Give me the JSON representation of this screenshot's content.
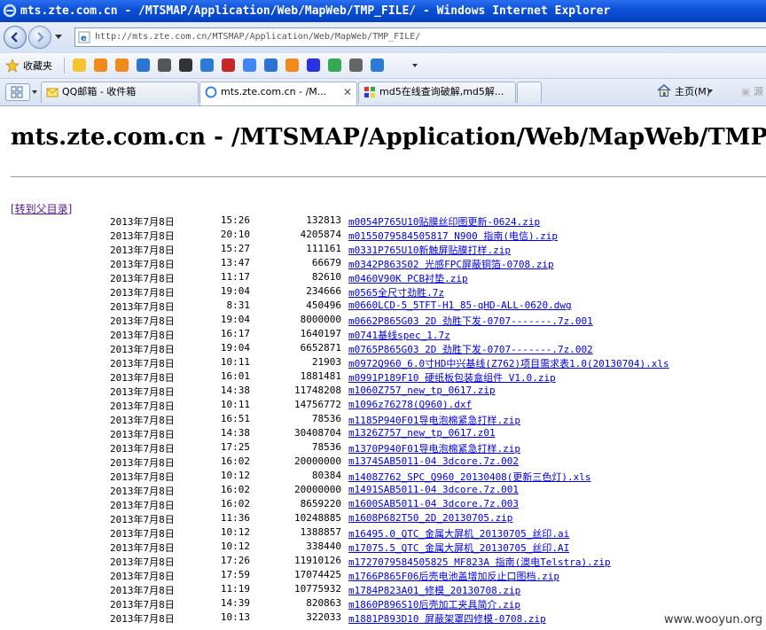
{
  "window": {
    "title": "mts.zte.com.cn - /MTSMAP/Application/Web/MapWeb/TMP_FILE/ - Windows Internet Explorer"
  },
  "address_bar": {
    "url": "http://mts.zte.com.cn/MTSMAP/Application/Web/MapWeb/TMP_FILE/"
  },
  "favorites_bar": {
    "label": "收藏夹",
    "icons": [
      "add-favorite-icon",
      "orange-site-icon",
      "orange-site-icon",
      "blue-site-icon",
      "link-icon",
      "download-icon",
      "ie-icon",
      "red-site-icon",
      "translate-icon",
      "blue-site-icon",
      "orange-site-icon",
      "baidu-paw-icon",
      "chrome-icon",
      "grid-icon",
      "ie-icon"
    ]
  },
  "tabs": [
    {
      "label": "QQ邮箱 - 收件箱",
      "active": false
    },
    {
      "label": "mts.zte.com.cn - /M...",
      "active": true
    },
    {
      "label": "md5在线查询破解,md5解...",
      "active": false
    }
  ],
  "toolbar": {
    "home_label": "主页(M)",
    "feeds_label": "源"
  },
  "page": {
    "title": "mts.zte.com.cn - /MTSMAP/Application/Web/MapWeb/TMP_FILE/",
    "parent_link": "[转到父目录]",
    "files": [
      {
        "date": "2013年7月8日",
        "time": "15:26",
        "size": "132813",
        "name": "m0054P765U10贴膜丝印图更新-0624.zip"
      },
      {
        "date": "2013年7月8日",
        "time": "20:10",
        "size": "4205874",
        "name": "m0155079584505817 N900 指南(电信).zip"
      },
      {
        "date": "2013年7月8日",
        "time": "15:27",
        "size": "111161",
        "name": "m0331P765U10新触屏贴膜打样.zip"
      },
      {
        "date": "2013年7月8日",
        "time": "13:47",
        "size": "66679",
        "name": "m0342P863S02 光感FPC屏蔽铜箔-0708.zip"
      },
      {
        "date": "2013年7月8日",
        "time": "11:17",
        "size": "82610",
        "name": "m0460V90K PCB衬垫.zip"
      },
      {
        "date": "2013年7月8日",
        "time": "19:04",
        "size": "234666",
        "name": "m0565全尺寸劲胜.7z"
      },
      {
        "date": "2013年7月8日",
        "time": "8:31",
        "size": "450496",
        "name": "m0660LCD-5_5TFT-H1_85-qHD-ALL-0620.dwg"
      },
      {
        "date": "2013年7月8日",
        "time": "19:04",
        "size": "8000000",
        "name": "m0662P865G03 2D 劲胜下发-0707-------.7z.001"
      },
      {
        "date": "2013年7月8日",
        "time": "16:17",
        "size": "1640197",
        "name": "m0741基线spec_1.7z"
      },
      {
        "date": "2013年7月8日",
        "time": "19:04",
        "size": "6652871",
        "name": "m0765P865G03 2D 劲胜下发-0707-------.7z.002"
      },
      {
        "date": "2013年7月8日",
        "time": "10:11",
        "size": "21903",
        "name": "m0972Q960_6.0寸HD中兴基线(Z762)项目需求表1.0(20130704).xls"
      },
      {
        "date": "2013年7月8日",
        "time": "16:01",
        "size": "1881481",
        "name": "m0991P189F10 硬纸板包装盒组件 V1.0.zip"
      },
      {
        "date": "2013年7月8日",
        "time": "14:38",
        "size": "11748208",
        "name": "m1060Z757_new_tp_0617.zip"
      },
      {
        "date": "2013年7月8日",
        "time": "10:11",
        "size": "14756772",
        "name": "m1096z76278(Q960).dxf"
      },
      {
        "date": "2013年7月8日",
        "time": "16:51",
        "size": "78536",
        "name": "m1185P940F01导电泡棉紧急打样.zip"
      },
      {
        "date": "2013年7月8日",
        "time": "14:38",
        "size": "30408704",
        "name": "m1326Z757_new_tp_0617.z01"
      },
      {
        "date": "2013年7月8日",
        "time": "17:25",
        "size": "78536",
        "name": "m1370P940F01导电泡棉紧急打样.zip"
      },
      {
        "date": "2013年7月8日",
        "time": "16:02",
        "size": "20000000",
        "name": "m1374SAB5011-04 3dcore.7z.002"
      },
      {
        "date": "2013年7月8日",
        "time": "10:12",
        "size": "80384",
        "name": "m1408Z762_SPC_Q960_20130408(更新三色灯).xls"
      },
      {
        "date": "2013年7月8日",
        "time": "16:02",
        "size": "20000000",
        "name": "m1491SAB5011-04 3dcore.7z.001"
      },
      {
        "date": "2013年7月8日",
        "time": "16:02",
        "size": "8659220",
        "name": "m1600SAB5011-04 3dcore.7z.003"
      },
      {
        "date": "2013年7月8日",
        "time": "11:36",
        "size": "10248885",
        "name": "m1608P682T50_2D_20130705.zip"
      },
      {
        "date": "2013年7月8日",
        "time": "10:12",
        "size": "1388857",
        "name": "m16495.0_QTC_金属大屏机_20130705_丝印.ai"
      },
      {
        "date": "2013年7月8日",
        "time": "10:12",
        "size": "338440",
        "name": "m17075.5_QTC_金属大屏机_20130705_丝印.AI"
      },
      {
        "date": "2013年7月8日",
        "time": "17:26",
        "size": "11910126",
        "name": "m1727079584505825 MF823A 指南(澳电Telstra).zip"
      },
      {
        "date": "2013年7月8日",
        "time": "17:59",
        "size": "17074425",
        "name": "m1766P865F06后壳电池盖增加反止口图档.zip"
      },
      {
        "date": "2013年7月8日",
        "time": "11:19",
        "size": "10775932",
        "name": "m1784P823A01_修模_20130708.zip"
      },
      {
        "date": "2013年7月8日",
        "time": "14:39",
        "size": "820863",
        "name": "m1860P896S10后壳加工夹具简介.zip"
      },
      {
        "date": "2013年7月8日",
        "time": "10:13",
        "size": "322033",
        "name": "m1881P893D10 屏蔽架罩四修模-0708.zip"
      }
    ]
  },
  "watermark": "www.wooyun.org"
}
